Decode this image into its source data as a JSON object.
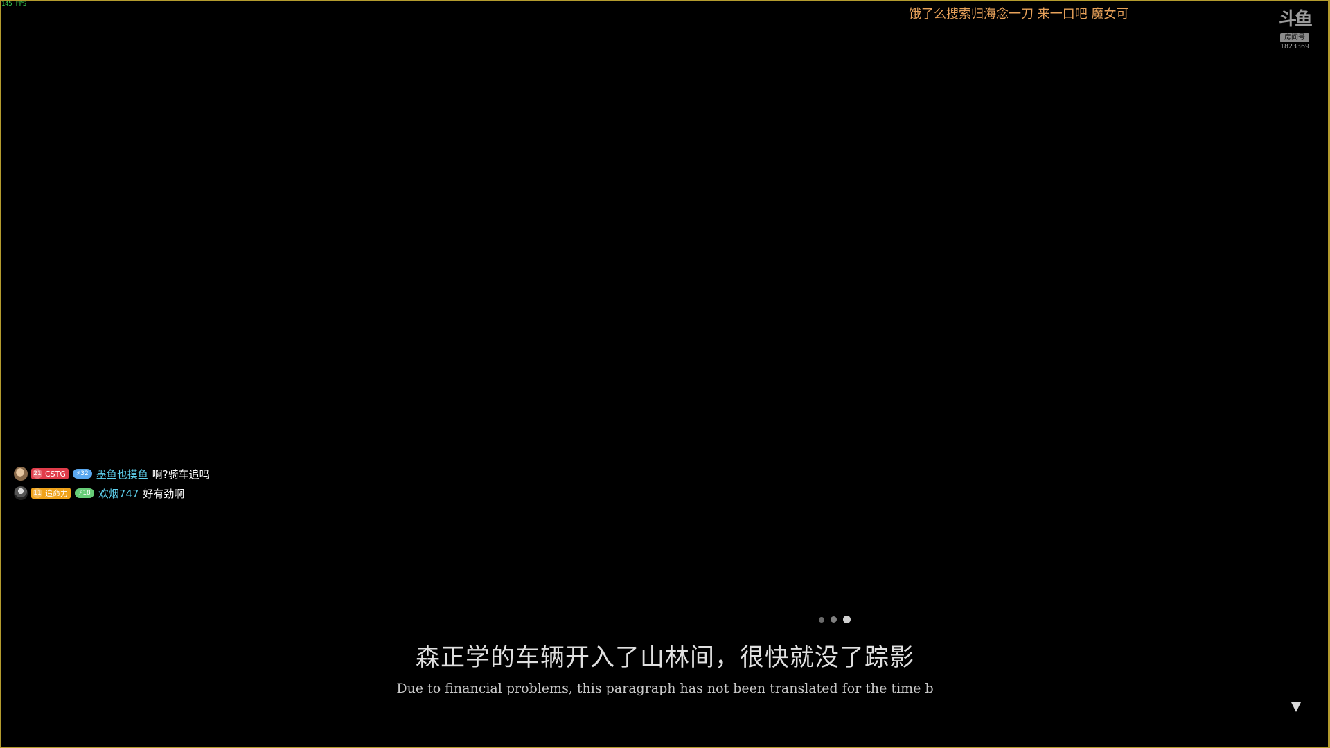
{
  "overlay": {
    "fps": "145 FPS"
  },
  "marquee": {
    "text": "饿了么搜索归海念一刀 来一口吧 魔女可"
  },
  "watermark": {
    "logo": "斗鱼",
    "tag": "房间号",
    "room_number": "1823369"
  },
  "chat": {
    "messages": [
      {
        "avatar_icon": "user-avatar-icon",
        "fan_level": "21",
        "fan_badge": "CSTG",
        "fan_color": "#e03c4a",
        "user_level": "32",
        "level_color": "#5aa8f0",
        "username": "墨鱼也摸鱼",
        "text": "啊?骑车追吗"
      },
      {
        "avatar_icon": "user-avatar-icon",
        "fan_level": "11",
        "fan_badge": "追命力",
        "fan_color": "#f0a21a",
        "user_level": "18",
        "level_color": "#66cc77",
        "username": "欢烟747",
        "text": "好有劲啊"
      }
    ]
  },
  "dialogue": {
    "text_cn": "森正学的车辆开入了山林间，很快就没了踪影",
    "text_en": "Due to financial problems, this paragraph has not been translated for the time b",
    "progress_dots": 3,
    "active_dot": 3,
    "next_icon": "triangle-down-icon"
  },
  "colors": {
    "frame": "#b39b2e",
    "marquee": "#e8a25a",
    "username": "#5fd4f2"
  }
}
